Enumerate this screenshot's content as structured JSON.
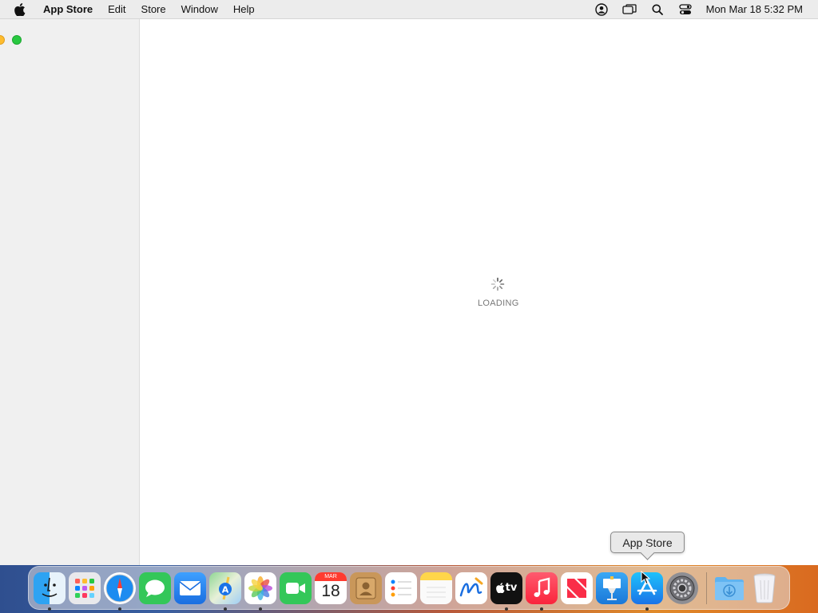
{
  "menubar": {
    "app_name": "App Store",
    "menus": [
      "Edit",
      "Store",
      "Window",
      "Help"
    ],
    "status_icons": [
      "user-account-icon",
      "screen-mirroring-icon",
      "spotlight-search-icon",
      "control-center-icon"
    ],
    "clock": "Mon Mar 18  5:32 PM"
  },
  "content": {
    "loading_text": "LOADING"
  },
  "tooltip": {
    "text": "App Store"
  },
  "dock": {
    "calendar_month": "MAR",
    "calendar_day": "18",
    "tv_label": "tv",
    "items": [
      {
        "name": "Finder",
        "icon": "finder-icon",
        "running": true
      },
      {
        "name": "Launchpad",
        "icon": "launchpad-icon",
        "running": false
      },
      {
        "name": "Safari",
        "icon": "safari-icon",
        "running": true
      },
      {
        "name": "Messages",
        "icon": "messages-icon",
        "running": false
      },
      {
        "name": "Mail",
        "icon": "mail-icon",
        "running": false
      },
      {
        "name": "Maps",
        "icon": "maps-icon",
        "running": true
      },
      {
        "name": "Photos",
        "icon": "photos-icon",
        "running": true
      },
      {
        "name": "FaceTime",
        "icon": "facetime-icon",
        "running": false
      },
      {
        "name": "Calendar",
        "icon": "calendar-icon",
        "running": false
      },
      {
        "name": "Contacts",
        "icon": "contacts-icon",
        "running": false
      },
      {
        "name": "Reminders",
        "icon": "reminders-icon",
        "running": false
      },
      {
        "name": "Notes",
        "icon": "notes-icon",
        "running": false
      },
      {
        "name": "Freeform",
        "icon": "freeform-icon",
        "running": false
      },
      {
        "name": "TV",
        "icon": "apple-tv-icon",
        "running": true
      },
      {
        "name": "Music",
        "icon": "music-icon",
        "running": true
      },
      {
        "name": "News",
        "icon": "news-icon",
        "running": false
      },
      {
        "name": "Keynote",
        "icon": "keynote-icon",
        "running": false
      },
      {
        "name": "App Store",
        "icon": "app-store-icon",
        "running": true
      },
      {
        "name": "System Settings",
        "icon": "system-settings-icon",
        "running": false
      },
      {
        "name": "Downloads",
        "icon": "downloads-folder-icon",
        "running": false
      },
      {
        "name": "Trash",
        "icon": "trash-icon",
        "running": false
      }
    ]
  },
  "colors": {
    "accent": "#0a84ff",
    "traffic_minimize": "#febc2e",
    "traffic_maximize": "#28c840"
  }
}
